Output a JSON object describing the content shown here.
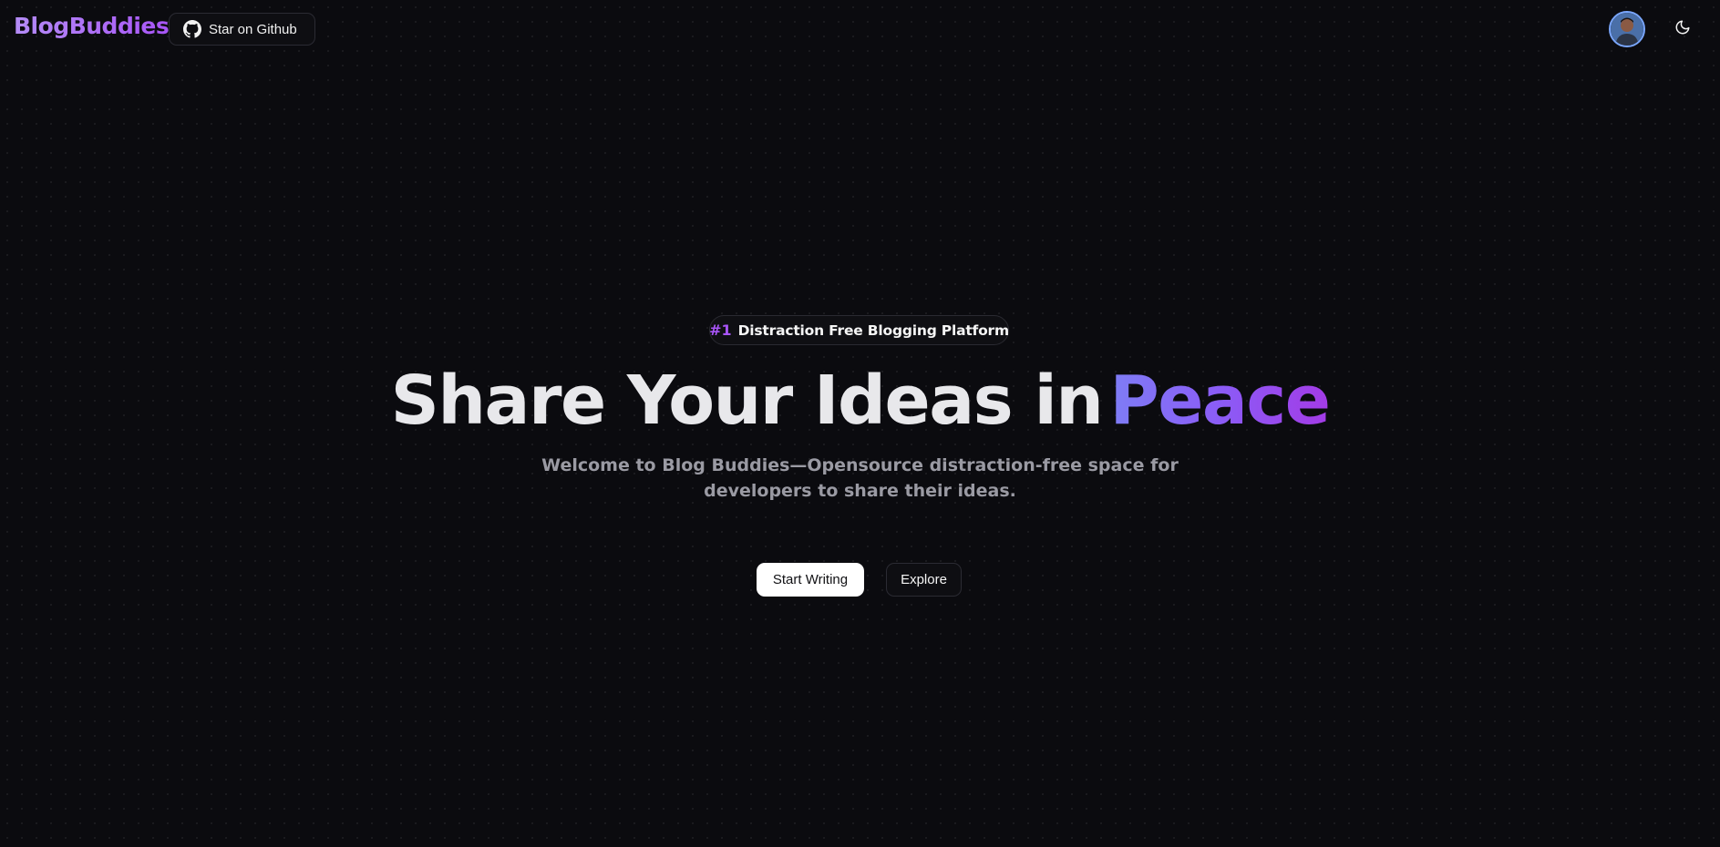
{
  "header": {
    "logo_text": "BlogBuddies",
    "github_button_label": "Star on Github",
    "github_icon": "github-icon",
    "avatar_icon": "user-avatar",
    "theme_toggle_icon": "moon-icon"
  },
  "hero": {
    "badge_number": "#1",
    "badge_text": "Distraction Free Blogging Platform",
    "headline_plain": "Share Your Ideas in",
    "headline_accent": "Peace",
    "subtitle": "Welcome to Blog Buddies—Opensource distraction-free space for developers to share their ideas.",
    "primary_button_label": "Start Writing",
    "secondary_button_label": "Explore"
  },
  "colors": {
    "background": "#0b0b0f",
    "accent_purple": "#a855f7",
    "accent_indigo": "#7e7df5",
    "text_muted": "#9a9aa3"
  }
}
